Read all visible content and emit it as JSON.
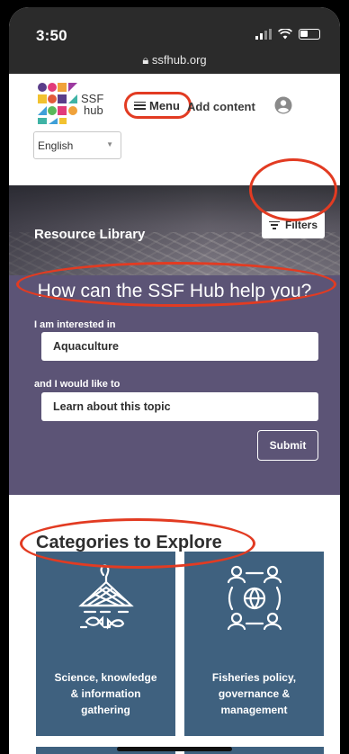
{
  "status_bar": {
    "time": "3:50",
    "url": "ssfhub.org"
  },
  "header": {
    "logo_text_line1": "SSF",
    "logo_text_line2": "hub",
    "menu_label": "Menu",
    "add_content_label": "Add content",
    "language": {
      "selected": "English"
    }
  },
  "hero": {
    "title": "Resource Library",
    "filters_label": "Filters"
  },
  "help": {
    "heading": "How can the SSF Hub help you?",
    "interest_label": "I am interested in",
    "interest_value": "Aquaculture",
    "goal_label": "and I would like to",
    "goal_value": "Learn about this topic",
    "submit_label": "Submit"
  },
  "categories": {
    "title": "Categories to Explore",
    "cards": [
      {
        "label_line1": "Science, knowledge",
        "label_line2": "& information",
        "label_line3": "gathering",
        "icon": "fishing-net-icon"
      },
      {
        "label_line1": "Fisheries policy,",
        "label_line2": "governance &",
        "label_line3": "management",
        "icon": "people-globe-icon"
      }
    ]
  },
  "colors": {
    "annotation_ring": "#e23b22",
    "help_panel": "#5c5476",
    "card_blue": "#3f617f",
    "status_bar": "#2b2b2b"
  }
}
